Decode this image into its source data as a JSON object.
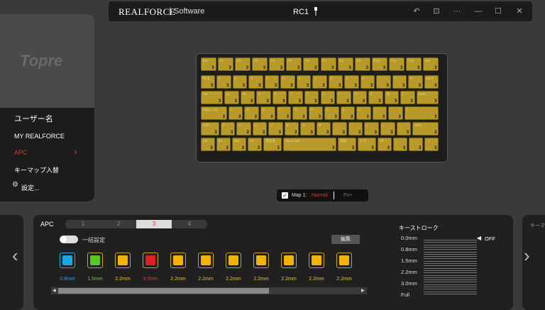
{
  "titlebar": {
    "brand": "REALFORCE",
    "separator": "|",
    "subtitle": "Software",
    "device": "RC1",
    "buttons": [
      "undo-icon",
      "save-icon",
      "more-icon",
      "minimize-icon",
      "maximize-icon",
      "close-icon"
    ]
  },
  "sidebar": {
    "logo": "Topre",
    "items": [
      {
        "label": "ユーザー名"
      },
      {
        "label": "MY REALFORCE"
      },
      {
        "label": "APC",
        "active": true
      },
      {
        "label": "キーマップ入替"
      },
      {
        "label": "設定..."
      }
    ]
  },
  "keyboard": {
    "key_color": "#b89a2a",
    "rows": [
      [
        {
          "l": "Esc"
        },
        {
          "l": "F1"
        },
        {
          "l": "F2"
        },
        {
          "l": "F3"
        },
        {
          "l": "F4"
        },
        {
          "l": "F5"
        },
        {
          "l": "F6"
        },
        {
          "l": "F7"
        },
        {
          "l": "F8"
        },
        {
          "l": "F9"
        },
        {
          "l": "F10"
        },
        {
          "l": "F11"
        },
        {
          "l": "F12"
        },
        {
          "l": "Del"
        }
      ],
      [
        {
          "l": "半/全"
        },
        {
          "l": "1"
        },
        {
          "l": "2"
        },
        {
          "l": "3"
        },
        {
          "l": "4"
        },
        {
          "l": "5"
        },
        {
          "l": "6"
        },
        {
          "l": "7"
        },
        {
          "l": "8"
        },
        {
          "l": "9"
        },
        {
          "l": "0"
        },
        {
          "l": "-"
        },
        {
          "l": "^"
        },
        {
          "l": "¥"
        },
        {
          "l": "Back"
        }
      ],
      [
        {
          "l": "Tab"
        },
        {
          "l": "Q"
        },
        {
          "l": "W"
        },
        {
          "l": "E"
        },
        {
          "l": "R"
        },
        {
          "l": "T"
        },
        {
          "l": "Y"
        },
        {
          "l": "U"
        },
        {
          "l": "I"
        },
        {
          "l": "O"
        },
        {
          "l": "P"
        },
        {
          "l": "@"
        },
        {
          "l": "["
        },
        {
          "l": "Enter"
        }
      ],
      [
        {
          "l": "Caps Lock"
        },
        {
          "l": "A"
        },
        {
          "l": "S"
        },
        {
          "l": "D"
        },
        {
          "l": "F"
        },
        {
          "l": "G"
        },
        {
          "l": "H"
        },
        {
          "l": "J"
        },
        {
          "l": "K"
        },
        {
          "l": "L"
        },
        {
          "l": ";"
        },
        {
          "l": ":"
        },
        {
          "l": "]"
        }
      ],
      [
        {
          "l": "Shift"
        },
        {
          "l": "Z"
        },
        {
          "l": "X"
        },
        {
          "l": "C"
        },
        {
          "l": "V"
        },
        {
          "l": "B"
        },
        {
          "l": "N"
        },
        {
          "l": "M"
        },
        {
          "l": ","
        },
        {
          "l": "."
        },
        {
          "l": "/"
        },
        {
          "l": "\\"
        },
        {
          "l": "↑"
        },
        {
          "l": "Shift"
        }
      ],
      [
        {
          "l": "Ctrl"
        },
        {
          "l": "Fn"
        },
        {
          "l": "Win"
        },
        {
          "l": "Alt"
        },
        {
          "l": "無変換"
        },
        {
          "l": "Space Bar"
        },
        {
          "l": "変換"
        },
        {
          "l": "かな"
        },
        {
          "l": "Alt"
        },
        {
          "l": "←"
        },
        {
          "l": "↓"
        },
        {
          "l": "→"
        }
      ]
    ],
    "key_value": "3"
  },
  "mapbar": {
    "label": "Map 1:",
    "normal": "Normal",
    "fn": "Fn+"
  },
  "apc": {
    "title": "APC",
    "tabs": [
      "1",
      "2",
      "3",
      "4"
    ],
    "active_tab": 2,
    "bulk_label": "一括設定",
    "edit_label": "編集",
    "swatches": [
      {
        "color": "#1fa8e0",
        "label": "0.8mm",
        "selected": true
      },
      {
        "color": "#5cc41c",
        "label": "1.5mm"
      },
      {
        "color": "#f0b400",
        "label": "2.2mm"
      },
      {
        "color": "#e02020",
        "label": "3.0mm"
      },
      {
        "color": "#f0b400",
        "label": "2.2mm"
      },
      {
        "color": "#f0b400",
        "label": "2.2mm"
      },
      {
        "color": "#f0b400",
        "label": "2.2mm"
      },
      {
        "color": "#f0b400",
        "label": "2.2mm"
      },
      {
        "color": "#f0b400",
        "label": "2.2mm"
      },
      {
        "color": "#f0b400",
        "label": "2.2mm"
      },
      {
        "color": "#f0b400",
        "label": "2.2mm"
      }
    ]
  },
  "keystroke": {
    "title": "キーストローク",
    "levels": [
      "0.0mm",
      "0.8mm",
      "1.5mm",
      "2.2mm",
      "3.0mm",
      "Full"
    ],
    "off_label": "OFF"
  },
  "right_stub": {
    "title": "キーマ"
  }
}
